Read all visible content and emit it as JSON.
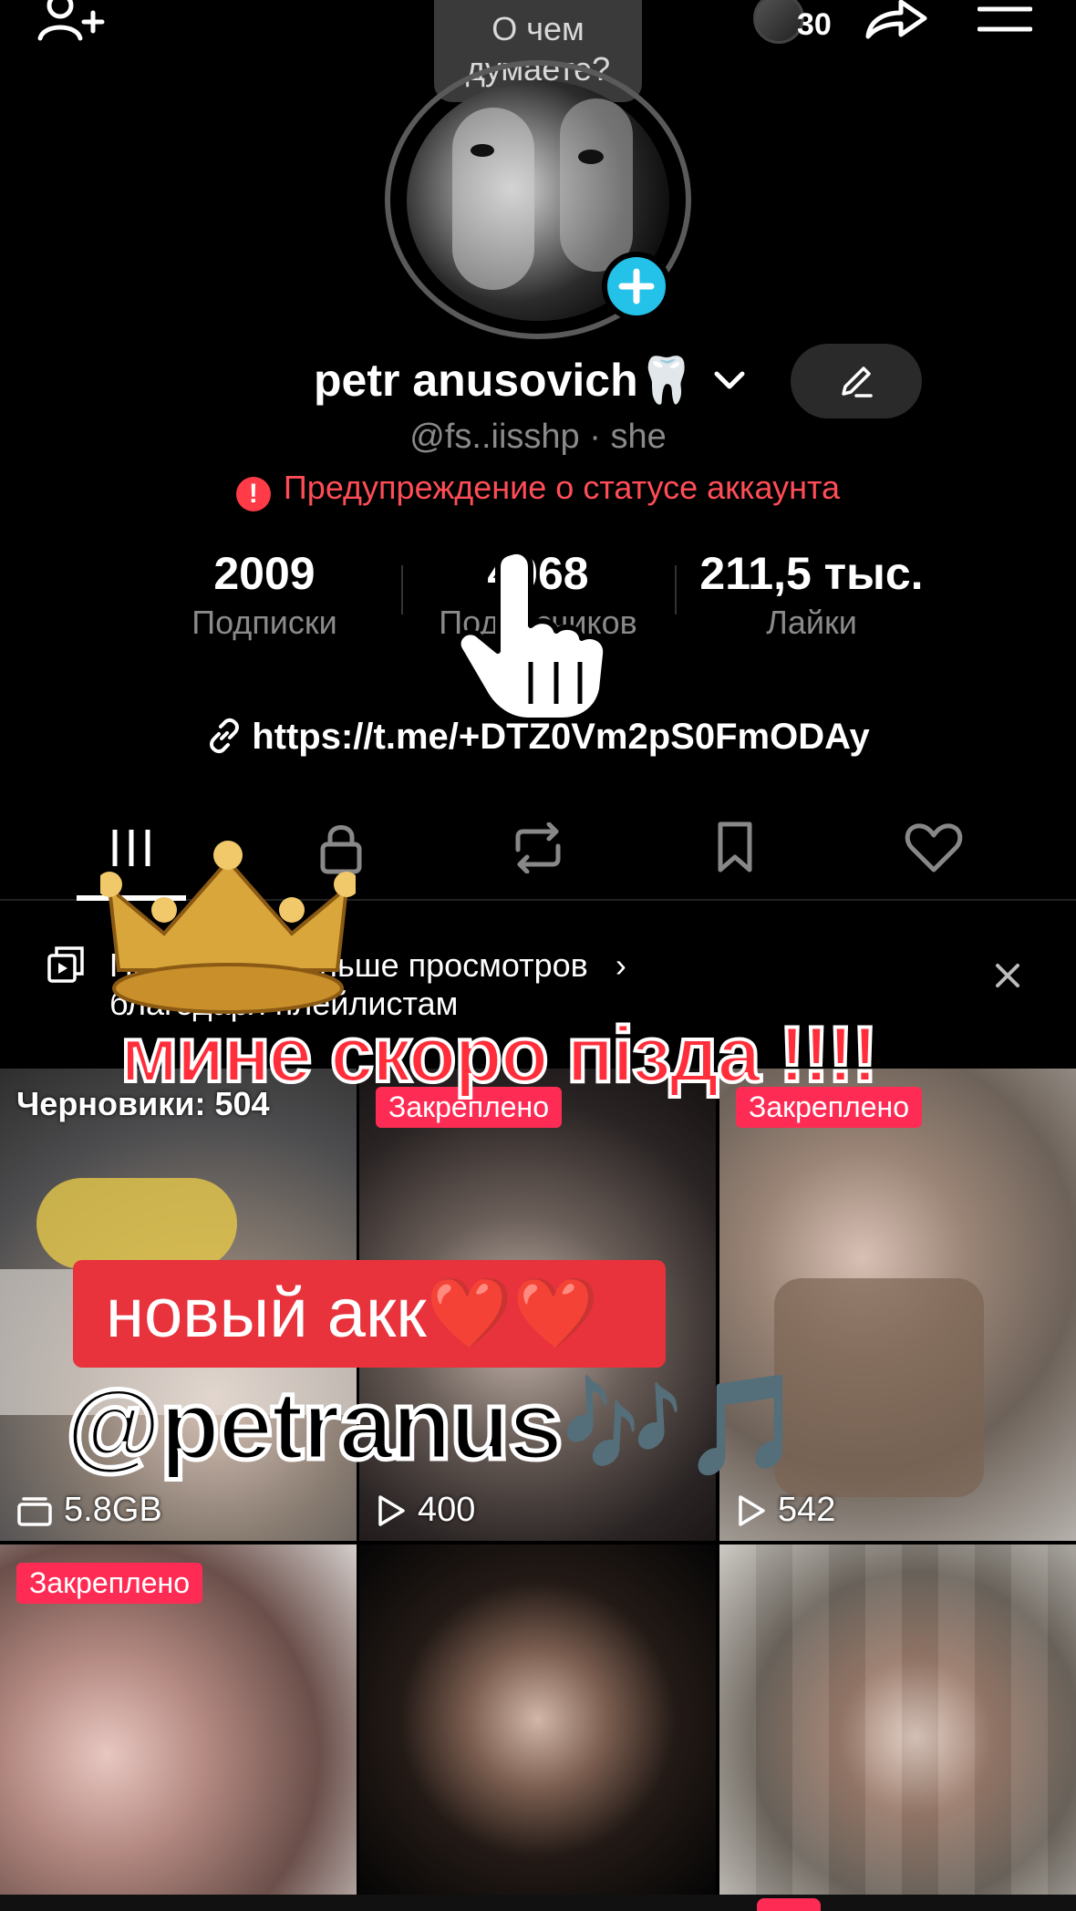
{
  "header": {
    "add_friend_icon": "person-plus-icon",
    "story_count": "30",
    "share_icon": "share-arrow-icon",
    "menu_icon": "hamburger-menu-icon",
    "note_bubble": "О чем думаете?"
  },
  "profile": {
    "display_name": "petr anusovich🦷",
    "handle_line": "@fs..iisshp · she",
    "warning": "Предупреждение о статусе аккаунта",
    "link": "https://t.me/+DTZ0Vm2pS0FmODAy"
  },
  "stats": [
    {
      "value": "2009",
      "label": "Подписки"
    },
    {
      "value": "4068",
      "label": "Подписчиков"
    },
    {
      "value": "211,5 тыс.",
      "label": "Лайки"
    }
  ],
  "tabs": [
    {
      "name": "videos",
      "icon": "grid-icon"
    },
    {
      "name": "private",
      "icon": "lock-icon"
    },
    {
      "name": "reposts",
      "icon": "repost-icon"
    },
    {
      "name": "favorites",
      "icon": "bookmark-icon"
    },
    {
      "name": "liked",
      "icon": "heart-icon"
    }
  ],
  "playlist_banner": {
    "line1": "Получайте больше просмотров",
    "line2": "благодаря плейлистам"
  },
  "grid": [
    {
      "top_label": "Черновики: 504",
      "type": "drafts",
      "stat": "5.8GB"
    },
    {
      "top_label": "Закреплено",
      "type": "pinned",
      "stat": "400"
    },
    {
      "top_label": "Закреплено",
      "type": "pinned",
      "stat": "542"
    },
    {
      "top_label": "Закреплено",
      "type": "pinned",
      "stat": ""
    },
    {
      "top_label": "",
      "type": "video",
      "stat": ""
    },
    {
      "top_label": "",
      "type": "video",
      "stat": ""
    }
  ],
  "overlays": {
    "red_text": "мине скоро пiзда !!!!",
    "new_account": "новый акк❤️❤️",
    "new_handle": "@petranus🎶🎵"
  },
  "colors": {
    "accent_pink": "#fe2c55",
    "warning_red": "#ff4d57",
    "plus_blue": "#24c1e8"
  }
}
